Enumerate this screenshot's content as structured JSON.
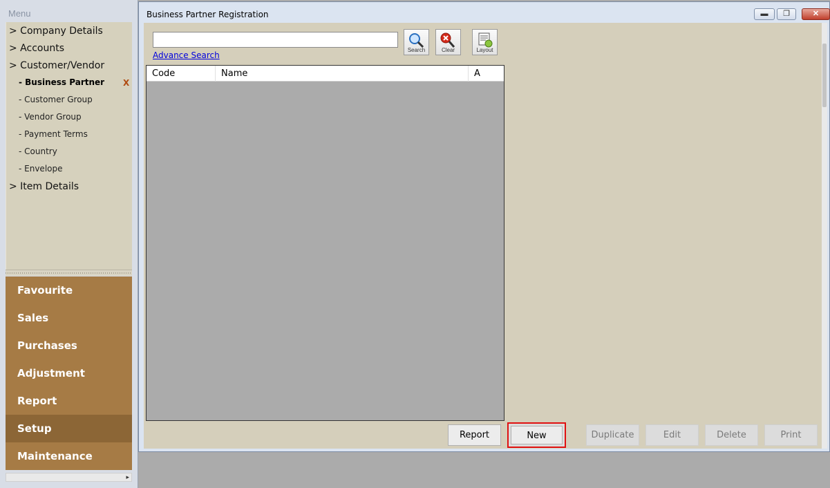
{
  "menu": {
    "title": "Menu",
    "tree": [
      {
        "label": "> Company Details"
      },
      {
        "label": "> Accounts"
      },
      {
        "label": "> Customer/Vendor"
      },
      {
        "label": "- Business Partner"
      },
      {
        "label": "- Customer Group"
      },
      {
        "label": "- Vendor Group"
      },
      {
        "label": "- Payment Terms"
      },
      {
        "label": "- Country"
      },
      {
        "label": "- Envelope"
      },
      {
        "label": "> Item Details"
      }
    ],
    "close_mark": "X",
    "sections": [
      "Favourite",
      "Sales",
      "Purchases",
      "Adjustment",
      "Report",
      "Setup",
      "Maintenance"
    ],
    "active_section": "Setup"
  },
  "window": {
    "title": "Business Partner Registration",
    "minimize_icon": "minimize-icon",
    "maximize_icon": "restore-icon",
    "close_icon": "close-icon"
  },
  "search": {
    "value": "",
    "advance_link": "Advance Search"
  },
  "toolbar": {
    "search_label": "Search",
    "clear_label": "Clear",
    "layout_label": "Layout"
  },
  "grid": {
    "columns": [
      "Code",
      "Name",
      "A"
    ],
    "rows": []
  },
  "actions": {
    "report": "Report",
    "new": "New",
    "duplicate": "Duplicate",
    "edit": "Edit",
    "delete": "Delete",
    "print": "Print"
  },
  "colors": {
    "section_bg": "#a67b45",
    "section_active_bg": "#8c6636",
    "highlight": "#e01010"
  }
}
